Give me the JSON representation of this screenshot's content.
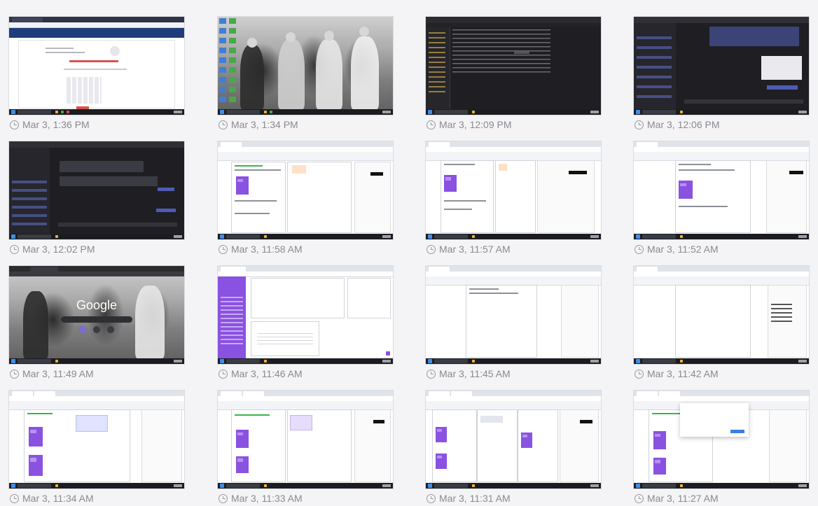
{
  "colors": {
    "background": "#f4f4f6",
    "caption_text": "#8a8a8f",
    "taskbar": "#1b1c21",
    "brand_purple": "#8a52e0",
    "teams_dark": "#1f1f23"
  },
  "screenshots": [
    {
      "time": "Mar 3, 1:36 PM",
      "kind": "browser-calendar"
    },
    {
      "time": "Mar 3, 1:34 PM",
      "kind": "desktop-photo"
    },
    {
      "time": "Mar 3, 12:09 PM",
      "kind": "file-explorer"
    },
    {
      "time": "Mar 3, 12:06 PM",
      "kind": "teams-chat"
    },
    {
      "time": "Mar 3, 12:02 PM",
      "kind": "teams-chat"
    },
    {
      "time": "Mar 3, 11:58 AM",
      "kind": "document-editor"
    },
    {
      "time": "Mar 3, 11:57 AM",
      "kind": "document-editor"
    },
    {
      "time": "Mar 3, 11:52 AM",
      "kind": "document-editor"
    },
    {
      "time": "Mar 3, 11:49 AM",
      "kind": "google-homepage"
    },
    {
      "time": "Mar 3, 11:46 AM",
      "kind": "dashboard"
    },
    {
      "time": "Mar 3, 11:45 AM",
      "kind": "document-editor"
    },
    {
      "time": "Mar 3, 11:42 AM",
      "kind": "document-editor"
    },
    {
      "time": "Mar 3, 11:34 AM",
      "kind": "document-editor"
    },
    {
      "time": "Mar 3, 11:33 AM",
      "kind": "document-editor"
    },
    {
      "time": "Mar 3, 11:31 AM",
      "kind": "document-editor"
    },
    {
      "time": "Mar 3, 11:27 AM",
      "kind": "document-editor"
    }
  ],
  "thumb_text": {
    "google_logo": "Google"
  }
}
